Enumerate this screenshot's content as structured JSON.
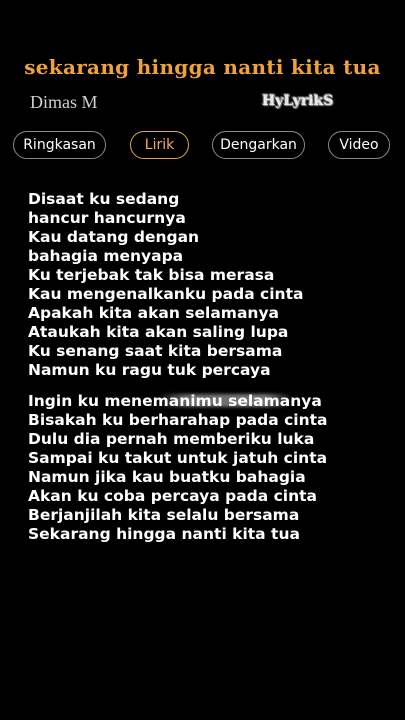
{
  "song_title": "sekarang hingga nanti kita tua",
  "artist": "Dimas M",
  "watermark": "HyLyrikS",
  "tabs": [
    {
      "label": "Ringkasan",
      "active": false
    },
    {
      "label": "Lirik",
      "active": true
    },
    {
      "label": "Dengarkan",
      "active": false
    },
    {
      "label": "Video",
      "active": false
    }
  ],
  "colors": {
    "accent": "#f0a23a",
    "background": "#000000",
    "text": "#ffffff"
  },
  "lyrics": {
    "verse1": [
      "Disaat ku sedang",
      "hancur hancurnya",
      "Kau datang dengan",
      "bahagia menyapa",
      "Ku terjebak tak bisa merasa",
      "Kau mengenalkanku pada cinta",
      "Apakah kita akan selamanya",
      "Ataukah kita akan saling lupa",
      "Ku senang saat kita bersama",
      "Namun ku ragu tuk percaya"
    ],
    "verse2": [
      "Ingin ku menemanimu selamanya",
      "Bisakah ku berharahap pada cinta",
      "Dulu dia pernah memberiku luka",
      "Sampai ku takut untuk jatuh cinta",
      "Namun jika kau buatku bahagia",
      "Akan ku coba percaya pada cinta",
      "Berjanjilah kita selalu bersama",
      "Sekarang hingga nanti kita tua"
    ]
  }
}
